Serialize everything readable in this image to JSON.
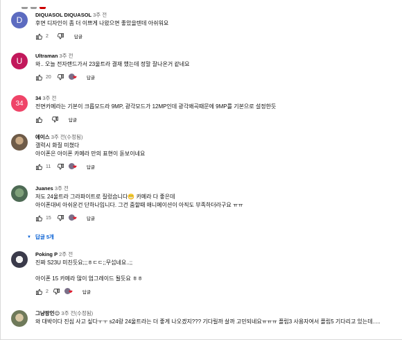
{
  "comments": [
    {
      "author": "DIQUASOL DIQUASOL",
      "time": "3주 전",
      "avatar_letter": "D",
      "avatar_color": "#5c6bc0",
      "lines": [
        "후면 디자인이 좀 더 이쁘게 나왔으면 좋았을텐데 아쉬워요"
      ],
      "likes": "2",
      "reply_label": "답글"
    },
    {
      "author": "Ultraman",
      "time": "3주 전",
      "avatar_letter": "U",
      "avatar_color": "#c2185b",
      "lines": [
        "와.. 오늘 전자랜드가서 23울트라 결재 했는데 정말 잘나온거 같네요"
      ],
      "likes": "20",
      "reply_label": "답글"
    },
    {
      "author": "34",
      "time": "3주 전",
      "avatar_letter": "34",
      "avatar_color": "#ef4468",
      "lines": [
        "전면카메라는 기본이 크롭모드라 9MP, 광각모드가 12MP인데 광각왜곡때문에 9MP를 기본으로 설정한듯"
      ],
      "likes": "",
      "reply_label": "답글"
    },
    {
      "author": "에이스",
      "time": "3주 전(수정됨)",
      "lines": [
        "갤럭시 화질 미쳤다",
        "아이폰은 아이폰 카메라 만의 표현이 돋보이네요"
      ],
      "likes": "11",
      "reply_label": "답글"
    },
    {
      "author": "Juanes",
      "time": "3주 전",
      "lines": [
        "저도 24울트라 그라파이트로 질렀습니다😬 카메라 다 좋은데",
        "아이폰대비 아쉬운건 단하나입니다. 그건 줌할때 애니메이션이 아직도 부족하더라구요 ㅠㅠ"
      ],
      "likes": "15",
      "reply_label": "답글"
    },
    {
      "author": "Poking P",
      "time": "2주 전",
      "lines": [
        "진짜 S23U 미친듯요;;;ㅎㄷㄷ;;무섭네요..;;",
        "아이폰 15 카메라 많이 업그레이드 될듯요 ㅎㅎ"
      ],
      "likes": "2",
      "reply_label": "답글"
    },
    {
      "author": "그냥팡인😌",
      "time": "3주 전(수정됨)",
      "lines": [
        "와 대박이다 진심 사고 싶다ㅜㅜ s24랑 24울트라는 더 좋게 나오겠지??? 기다릴까 살까 고민되네요ㅠㅠㅠ 플립3 사용자여서 플립5 기다리고 있는데....."
      ],
      "likes": "",
      "reply_label": ""
    }
  ],
  "replies_toggle": "답글 5개",
  "heart_color": "#e01b2d"
}
